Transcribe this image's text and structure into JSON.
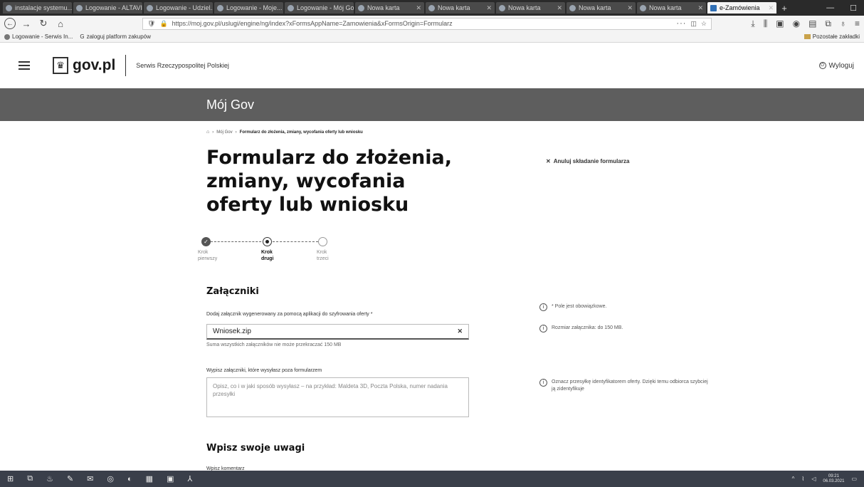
{
  "browser": {
    "tabs": [
      "instalacje systemu...",
      "Logowanie - ALTAVIO",
      "Logowanie - Udziel...",
      "Logowanie - Moje...",
      "Logowanie - Mój Gov",
      "Nowa karta",
      "Nowa karta",
      "Nowa karta",
      "Nowa karta",
      "Nowa karta"
    ],
    "active_tab": "e-Zamówienia",
    "new_tab": "+",
    "url": "https://moj.gov.pl/uslugi/engine/ng/index?xFormsAppName=Zamowienia&xFormsOrigin=Formularz",
    "bookmarks": [
      "Logowanie - Serwis In...",
      "zaloguj platform zakupów"
    ],
    "other_bookmarks": "Pozostałe zakładki"
  },
  "header": {
    "logo_text": "gov.pl",
    "service_name": "Serwis Rzeczypospolitej Polskiej",
    "logout": "Wyloguj"
  },
  "band": {
    "title": "Mój Gov"
  },
  "breadcrumb": {
    "items": [
      "Mój Gov",
      "Formularz do złożenia, zmiany, wycofania oferty lub wniosku"
    ]
  },
  "page": {
    "title": "Formularz do złożenia, zmiany, wycofania oferty lub wniosku",
    "cancel": "Anuluj składanie formularza"
  },
  "stepper": {
    "steps": [
      {
        "line1": "Krok",
        "line2": "pierwszy",
        "state": "done"
      },
      {
        "line1": "Krok",
        "line2": "drugi",
        "state": "current"
      },
      {
        "line1": "Krok",
        "line2": "trzeci",
        "state": "todo"
      }
    ]
  },
  "attachments": {
    "heading": "Załączniki",
    "file_label": "Dodaj załącznik wygenerowany za pomocą aplikacji do szyfrowania oferty *",
    "file_value": "Wniosek.zip",
    "file_hint": "Suma wszystkich załączników nie może przekraczać 150 MB",
    "other_label": "Wypisz załączniki, które wysyłasz poza formularzem",
    "other_placeholder": "Opisz, co i w jaki sposób wysyłasz – na przykład: Maldeta 3D, Poczta Polska, numer nadania przesyłki"
  },
  "sidebar_notes": {
    "required": "* Pole jest obowiązkowe.",
    "size": "Rozmiar załącznika: do 150 MB.",
    "identify": "Oznacz przesyłkę identyfikatorem oferty. Dzięki temu odbiorca szybciej ją zidentyfikuje"
  },
  "remarks": {
    "heading": "Wpisz swoje uwagi",
    "label": "Wpisz komentarz"
  },
  "taskbar": {
    "time": "09:21",
    "date": "06.03.2021"
  }
}
